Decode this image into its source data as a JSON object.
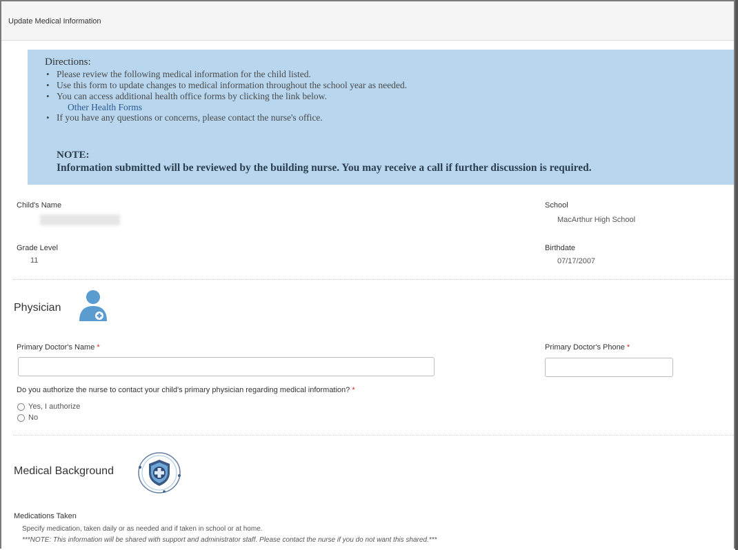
{
  "page_title": "Update Medical Information",
  "directions": {
    "heading": "Directions:",
    "items": [
      "Please review the following medical information for the child listed.",
      "Use this form to update changes to medical information throughout the school year as needed.",
      "You can access additional health office forms by clicking the link below.",
      "If you have any questions or concerns, please contact the nurse's office."
    ],
    "link_label": "Other Health Forms",
    "note_heading": "NOTE:",
    "note_text": "Information submitted will be reviewed by the building nurse. You may receive a call if further discussion is required."
  },
  "student": {
    "name_label": "Child's Name",
    "school_label": "School",
    "school_value": "MacArthur High School",
    "grade_label": "Grade Level",
    "grade_value": "11",
    "birthdate_label": "Birthdate",
    "birthdate_value": "07/17/2007"
  },
  "physician": {
    "title": "Physician",
    "icon": "doctor-icon",
    "doctor_name_label": "Primary Doctor's Name",
    "doctor_phone_label": "Primary Doctor's Phone",
    "required_mark": "*",
    "authorize_question": "Do you authorize the nurse to contact your child's primary physician regarding medical information?",
    "options": [
      "Yes, I authorize",
      "No"
    ]
  },
  "medical_background": {
    "title": "Medical Background",
    "icon": "medical-shield-icon",
    "medications_label": "Medications Taken",
    "medications_help": "Specify medication, taken daily or as needed and if taken in school or at home.",
    "medications_note": "***NOTE: This information will be shared with support and administrator staff. Please contact the nurse if you do not want this shared.***"
  },
  "colors": {
    "directions_bg": "#b8d6ee",
    "link": "#2a5a92",
    "icon_blue": "#5a9bd0",
    "required": "#c62828"
  }
}
